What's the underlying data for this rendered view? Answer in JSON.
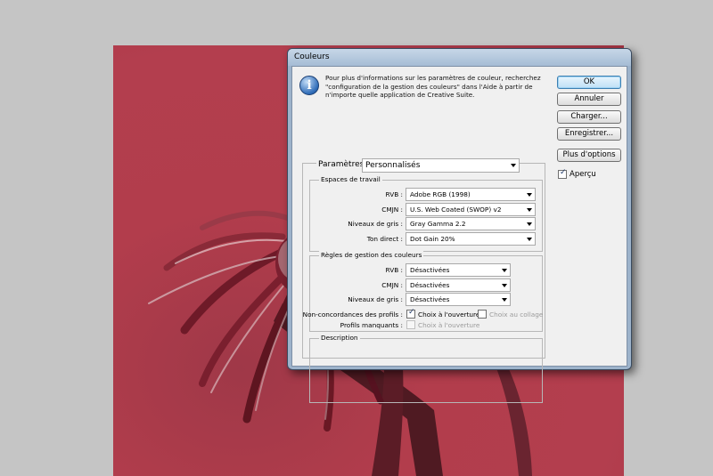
{
  "dialog": {
    "title": "Couleurs",
    "info_text": "Pour plus d'informations sur les paramètres de couleur, recherchez \"configuration de la gestion des couleurs\" dans l'Aide à partir de n'importe quelle application de Creative Suite.",
    "info_icon": "info-icon"
  },
  "settings": {
    "label": "Paramètres :",
    "value": "Personnalisés"
  },
  "working_spaces": {
    "title": "Espaces de travail",
    "rgb_label": "RVB :",
    "rgb_value": "Adobe RGB (1998)",
    "cmyk_label": "CMJN :",
    "cmyk_value": "U.S. Web Coated (SWOP) v2",
    "gray_label": "Niveaux de gris :",
    "gray_value": "Gray Gamma 2.2",
    "spot_label": "Ton direct :",
    "spot_value": "Dot Gain 20%"
  },
  "policies": {
    "title": "Règles de gestion des couleurs",
    "rgb_label": "RVB :",
    "rgb_value": "Désactivées",
    "cmyk_label": "CMJN :",
    "cmyk_value": "Désactivées",
    "gray_label": "Niveaux de gris :",
    "gray_value": "Désactivées",
    "mismatch_label": "Non-concordances des profils :",
    "ask_open_label": "Choix à l'ouverture",
    "ask_open_checked": true,
    "ask_paste_label": "Choix au collage",
    "ask_paste_checked": false,
    "missing_label": "Profils manquants :",
    "missing_open_label": "Choix à l'ouverture",
    "missing_open_checked": false
  },
  "description": {
    "title": "Description"
  },
  "buttons": {
    "ok": "OK",
    "cancel": "Annuler",
    "load": "Charger...",
    "save": "Enregistrer...",
    "more_options": "Plus d'options"
  },
  "preview": {
    "label": "Aperçu",
    "checked": true
  },
  "colors": {
    "background_photo": "#b23d4c",
    "dialog_frame": "#9db3cb",
    "default_button": "#3c7fb1"
  }
}
